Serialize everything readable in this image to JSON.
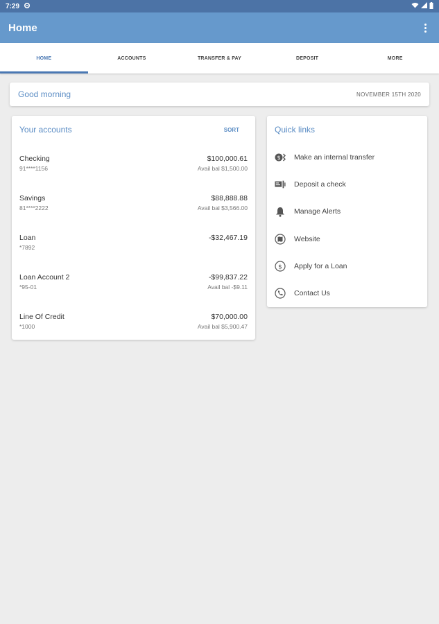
{
  "status_bar": {
    "time": "7:29"
  },
  "app_bar": {
    "title": "Home"
  },
  "tabs": [
    {
      "label": "HOME"
    },
    {
      "label": "ACCOUNTS"
    },
    {
      "label": "TRANSFER & PAY"
    },
    {
      "label": "DEPOSIT"
    },
    {
      "label": "MORE"
    }
  ],
  "greeting": {
    "text": "Good morning",
    "date": "NOVEMBER 15TH 2020"
  },
  "accounts": {
    "heading": "Your accounts",
    "sort_label": "SORT",
    "items": [
      {
        "name": "Checking",
        "number": "91****1156",
        "balance": "$100,000.61",
        "avail": "Avail bal $1,500.00"
      },
      {
        "name": "Savings",
        "number": "81****2222",
        "balance": "$88,888.88",
        "avail": "Avail bal $3,566.00"
      },
      {
        "name": "Loan",
        "number": "*7892",
        "balance": "-$32,467.19",
        "avail": ""
      },
      {
        "name": "Loan Account 2",
        "number": "*95-01",
        "balance": "-$99,837.22",
        "avail": "Avail bal -$9.11"
      },
      {
        "name": "Line Of Credit",
        "number": "*1000",
        "balance": "$70,000.00",
        "avail": "Avail bal $5,900.47"
      }
    ]
  },
  "quick_links": {
    "heading": "Quick links",
    "items": [
      {
        "label": "Make an internal transfer",
        "icon": "transfer-icon"
      },
      {
        "label": "Deposit a check",
        "icon": "check-deposit-icon"
      },
      {
        "label": "Manage Alerts",
        "icon": "bell-icon"
      },
      {
        "label": "Website",
        "icon": "map-icon"
      },
      {
        "label": "Apply for a Loan",
        "icon": "dollar-icon"
      },
      {
        "label": "Contact Us",
        "icon": "phone-icon"
      }
    ]
  },
  "colors": {
    "status_bar": "#4c73a6",
    "app_bar": "#6699cc",
    "accent": "#4a78b3",
    "link": "#5a8cc4",
    "background": "#ededed"
  }
}
